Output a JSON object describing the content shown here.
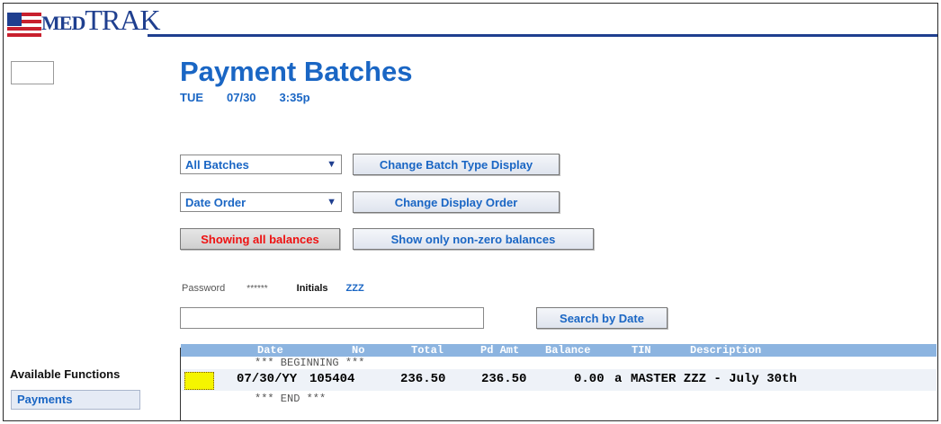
{
  "app": {
    "logo_text": "TRAK",
    "logo_prefix": "MED"
  },
  "page": {
    "title": "Payment Batches",
    "day": "TUE",
    "date": "07/30",
    "time": "3:35p"
  },
  "controls": {
    "batch_select_value": "All Batches",
    "change_batch_type_label": "Change Batch Type Display",
    "order_select_value": "Date Order",
    "change_order_label": "Change Display Order",
    "showing_all_label": "Showing all balances",
    "show_nonzero_label": "Show only non-zero balances",
    "password_label": "Password",
    "password_value": "******",
    "initials_label": "Initials",
    "initials_value": "ZZZ",
    "search_value": "",
    "search_by_date_label": "Search by Date"
  },
  "table": {
    "columns": [
      "Date",
      "No",
      "Total",
      "Pd Amt",
      "Balance",
      "TIN",
      "Description"
    ],
    "beginning_marker": "*** BEGINNING ***",
    "rows": [
      {
        "date": "07/30/YY",
        "no": "105404",
        "total": "236.50",
        "pd_amt": "236.50",
        "balance": "0.00",
        "tin": "a",
        "description": "MASTER ZZZ - July 30th"
      }
    ],
    "end_marker": "*** END ***"
  },
  "sidebar": {
    "heading": "Available Functions",
    "items": [
      {
        "label": "Payments"
      }
    ]
  },
  "colors": {
    "accent": "#1a66c4",
    "brand": "#1f3f8f",
    "header_row": "#8cb4e0",
    "selection": "#f5f500",
    "alert": "#e11111"
  }
}
